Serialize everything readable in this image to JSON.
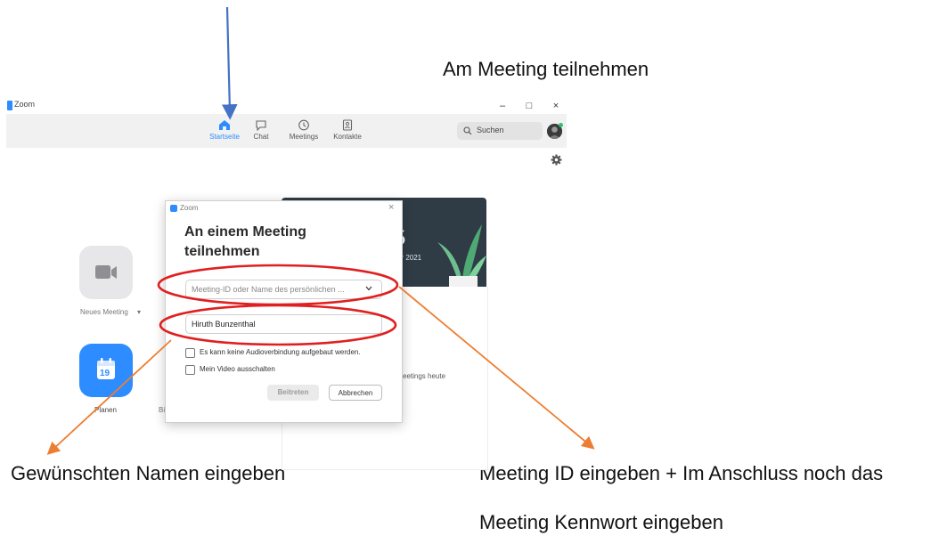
{
  "annotations": {
    "title": "Am Meeting teilnehmen",
    "name_hint": "Gewünschten Namen eingeben",
    "id_hint_line1": "Meeting ID eingeben + Im Anschluss noch das",
    "id_hint_line2": "Meeting Kennwort eingeben",
    "arrow_color": "#4472c4",
    "hint_arrow_color": "#ed7d31",
    "ellipse_color": "#e02020"
  },
  "window": {
    "app_title": "Zoom",
    "minimize": "–",
    "maximize": "□",
    "close": "×"
  },
  "nav": {
    "items": [
      {
        "label": "Startseite",
        "icon": "home-icon"
      },
      {
        "label": "Chat",
        "icon": "chat-icon"
      },
      {
        "label": "Meetings",
        "icon": "clock-icon"
      },
      {
        "label": "Kontakte",
        "icon": "contacts-icon"
      }
    ],
    "active_color": "#2d8cff",
    "search_label": "Suchen"
  },
  "home": {
    "new_meeting_label": "Neues Meeting",
    "new_meeting_caret": "▾",
    "plan_label": "Planen",
    "plan_day": "19",
    "plan_label_partial": "Bi",
    "card_big": "5",
    "card_date": "er 2021",
    "meetings_today": "eetings heute"
  },
  "dialog": {
    "app_title": "Zoom",
    "close": "×",
    "heading": "An einem Meeting teilnehmen",
    "meeting_id_placeholder": "Meeting-ID oder Name des persönlichen ...",
    "name_value": "Hiruth Bunzenthal",
    "no_audio_label": "Es kann keine Audioverbindung aufgebaut werden.",
    "no_video_label": "Mein Video ausschalten",
    "join_label": "Beitreten",
    "cancel_label": "Abbrechen"
  }
}
